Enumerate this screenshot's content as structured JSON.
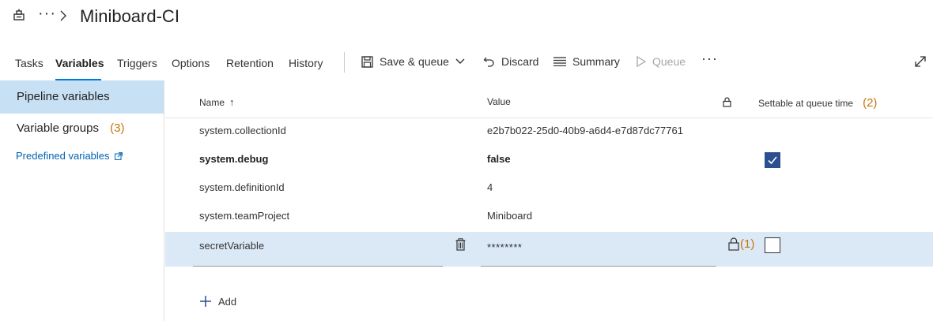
{
  "header": {
    "ellipsis": "···",
    "title": "Miniboard-CI"
  },
  "tabs": [
    {
      "label": "Tasks",
      "active": false
    },
    {
      "label": "Variables",
      "active": true
    },
    {
      "label": "Triggers",
      "active": false
    },
    {
      "label": "Options",
      "active": false
    },
    {
      "label": "Retention",
      "active": false
    },
    {
      "label": "History",
      "active": false
    }
  ],
  "toolbar": {
    "save_queue": "Save & queue",
    "discard": "Discard",
    "summary": "Summary",
    "queue": "Queue",
    "more": "···"
  },
  "sidebar": {
    "pipeline_variables": "Pipeline variables",
    "variable_groups": "Variable groups",
    "variable_groups_callout": "(3)",
    "predefined_variables": "Predefined variables"
  },
  "table": {
    "columns": {
      "name": "Name",
      "name_sort": "↑",
      "value": "Value",
      "settable": "Settable at queue time",
      "settable_callout": "(2)"
    },
    "rows": [
      {
        "name": "system.collectionId",
        "value": "e2b7b022-25d0-40b9-a6d4-e7d87dc77761",
        "bold": false,
        "settable": null
      },
      {
        "name": "system.debug",
        "value": "false",
        "bold": true,
        "settable": true
      },
      {
        "name": "system.definitionId",
        "value": "4",
        "bold": false,
        "settable": null
      },
      {
        "name": "system.teamProject",
        "value": "Miniboard",
        "bold": false,
        "settable": null
      }
    ],
    "secret_row": {
      "name": "secretVariable",
      "value": "********",
      "lock_callout": "(1)",
      "settable": false
    },
    "add_label": "Add"
  }
}
